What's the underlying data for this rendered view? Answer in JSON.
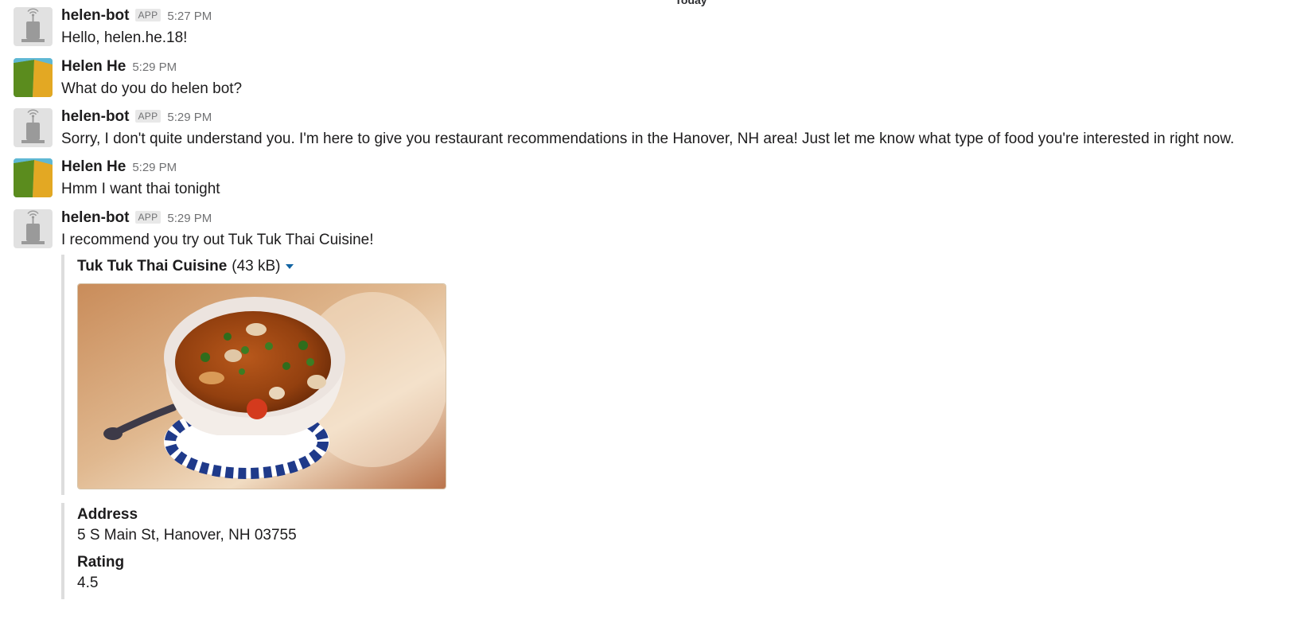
{
  "day_divider": "Today",
  "messages": [
    {
      "sender": "helen-bot",
      "badge": "APP",
      "time": "5:27 PM",
      "text": "Hello, helen.he.18!",
      "avatar": "bot-avatar-icon"
    },
    {
      "sender": "Helen He",
      "time": "5:29 PM",
      "text": "What do you do helen bot?",
      "avatar": "user-avatar"
    },
    {
      "sender": "helen-bot",
      "badge": "APP",
      "time": "5:29 PM",
      "text": "Sorry, I don't quite understand you. I'm here to give you restaurant recommendations in the Hanover, NH area! Just let me know what type of food you're interested in right now.",
      "avatar": "bot-avatar-icon"
    },
    {
      "sender": "Helen He",
      "time": "5:29 PM",
      "text": "Hmm I want thai tonight",
      "avatar": "user-avatar"
    },
    {
      "sender": "helen-bot",
      "badge": "APP",
      "time": "5:29 PM",
      "text": "I recommend you try out Tuk Tuk Thai Cuisine!",
      "avatar": "bot-avatar-icon"
    }
  ],
  "attachment": {
    "title": "Tuk Tuk Thai Cuisine",
    "size": "(43 kB)",
    "image_alt": "thai soup bowl photo",
    "fields": [
      {
        "title": "Address",
        "value": "5 S Main St, Hanover, NH 03755"
      },
      {
        "title": "Rating",
        "value": "4.5"
      }
    ]
  },
  "colors": {
    "accent": "#1264a3",
    "attachment_bar": "#dddddd",
    "user_avatar_green": "#5b8c1e",
    "user_avatar_gold": "#e3a823",
    "user_avatar_blue": "#5fb8d4"
  }
}
